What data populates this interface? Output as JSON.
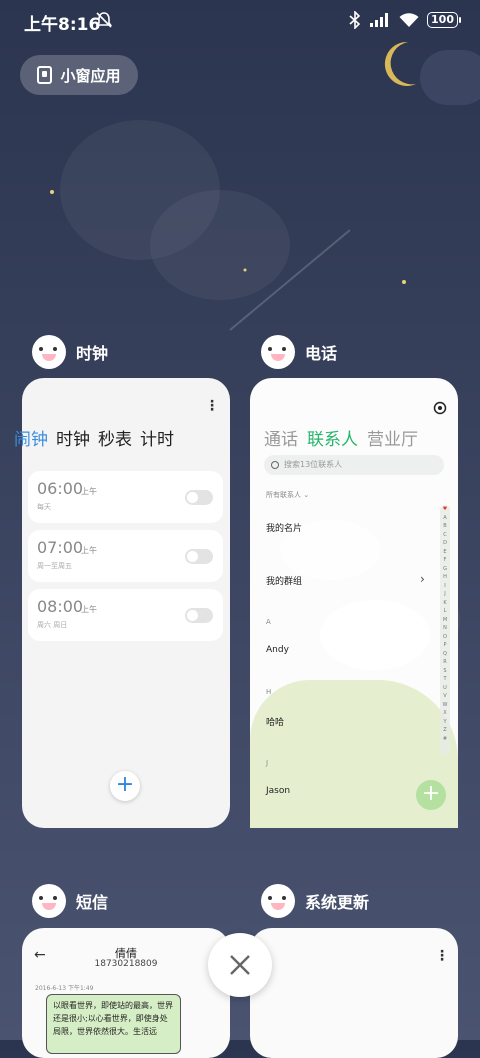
{
  "status_bar": {
    "time": "上午8:16",
    "battery": "100",
    "icons": [
      "mute-notification-icon",
      "bluetooth-icon",
      "signal-icon",
      "wifi-icon",
      "battery-icon"
    ]
  },
  "small_window": {
    "label": "小窗应用",
    "icon": "window-icon"
  },
  "colors": {
    "clock_accent": "#3c8fe0",
    "phone_accent": "#28b56c",
    "background": "#38415c"
  },
  "apps": {
    "clock": {
      "name": "时钟",
      "tabs": [
        "闹钟",
        "时钟",
        "秒表",
        "计时"
      ],
      "active_tab": 0,
      "alarms": [
        {
          "time": "06:00",
          "ampm": "上午",
          "repeat": "每天",
          "enabled": false
        },
        {
          "time": "07:00",
          "ampm": "上午",
          "repeat": "周一至周五",
          "enabled": false
        },
        {
          "time": "08:00",
          "ampm": "上午",
          "repeat": "周六 周日",
          "enabled": false
        }
      ],
      "add_label": "+"
    },
    "phone": {
      "name": "电话",
      "tabs": [
        "通话",
        "联系人",
        "营业厅"
      ],
      "active_tab": 1,
      "search_placeholder": "搜索13位联系人",
      "filter": "所有联系人",
      "my_card": "我的名片",
      "my_groups": "我的群组",
      "sections": [
        {
          "letter": "A",
          "name": "Andy"
        },
        {
          "letter": "H",
          "name": "哈哈"
        },
        {
          "letter": "J",
          "name": "Jason"
        }
      ],
      "index_letters": [
        "A",
        "B",
        "C",
        "D",
        "E",
        "F",
        "G",
        "H",
        "I",
        "J",
        "K",
        "L",
        "M",
        "N",
        "O",
        "P",
        "Q",
        "R",
        "S",
        "T",
        "U",
        "V",
        "W",
        "X",
        "Y",
        "Z",
        "#"
      ],
      "add_label": "+"
    },
    "sms": {
      "name": "短信",
      "contact": "倩倩",
      "number": "18730218809",
      "date": "2016-6-13 下午1:49",
      "message": "以眼看世界，即使站的最高，世界还是很小;以心看世界，即使身处局限，世界依然很大。生活远"
    },
    "update": {
      "name": "系统更新"
    }
  },
  "close_button": {
    "icon": "close-icon"
  }
}
